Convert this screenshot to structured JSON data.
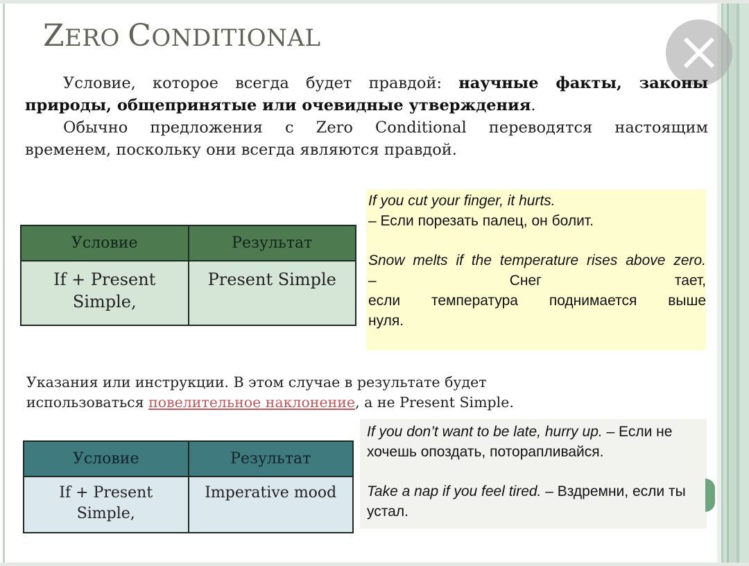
{
  "slide": {
    "title_parts": [
      {
        "text": "Z",
        "size": "large"
      },
      {
        "text": "ERO ",
        "size": "small"
      },
      {
        "text": "C",
        "size": "large"
      },
      {
        "text": "ONDITIONAL",
        "size": "small"
      }
    ],
    "close_button_label": "Close",
    "intro": {
      "p1_plain": "Условие, которое всегда будет правдой: ",
      "p1_bold_a": "научные факты, законы",
      "p1_bold_b": "природы, общепринятые или очевидные утверждения",
      "p1_end": ".",
      "p2_line1": "Обычно предложения с Zero Conditional переводятся настоящим",
      "p2_line2": "временем, поскольку они всегда являются правдой."
    },
    "table1": {
      "headers": [
        "Условие",
        "Результат"
      ],
      "rows": [
        [
          "If + Present Simple,",
          "Present Simple"
        ]
      ]
    },
    "examples1": [
      {
        "en": "If you cut your finger, it hurts.",
        "ru": "– Если порезать палец, он болит."
      },
      {
        "en": "Snow melts if the temperature rises above zero.",
        "ru_line1_left": "–",
        "ru_line1_mid": "Снег",
        "ru_line1_right": "тает,",
        "ru_line2": "если температура поднимается выше",
        "ru_line3": "нуля."
      }
    ],
    "instructions": {
      "line1": "Указания или инструкции. В этом случае в результате будет",
      "line2_before": "использоваться ",
      "link_text": "повелительное наклонение",
      "line2_after": ", а не Present Simple."
    },
    "table2": {
      "headers": [
        "Условие",
        "Результат"
      ],
      "rows": [
        [
          "If + Present Simple,",
          "Imperative mood"
        ]
      ]
    },
    "examples2": [
      {
        "en": "If you don’t want to be late, hurry up.",
        "ru": " – Если не хочешь опоздать, поторапливайся."
      },
      {
        "en": "Take a nap if you feel tired.",
        "ru": " – Вздремни, если ты устал."
      }
    ]
  },
  "colors": {
    "table1_header": "#4e7a50",
    "table1_body": "#d6e6d6",
    "table2_header": "#3f7a7f",
    "table2_body": "#dbe9ee",
    "examples1_bg": "#fdfdd0",
    "examples2_bg": "#f2f2ef",
    "link": "#c0595c",
    "title": "#5f6357"
  }
}
